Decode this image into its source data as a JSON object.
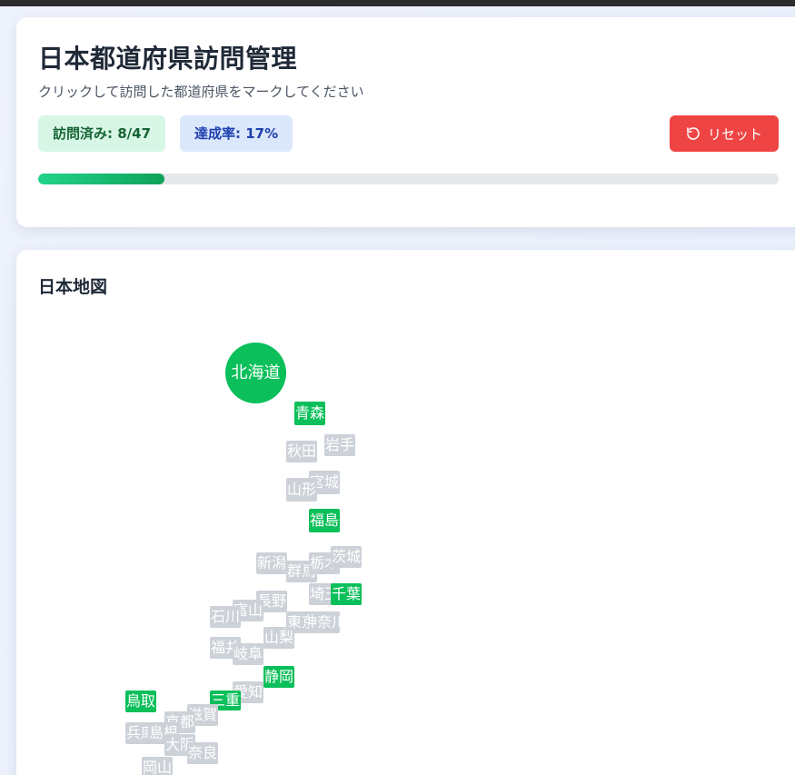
{
  "header": {
    "title": "日本都道府県訪問管理",
    "subtitle": "クリックして訪問した都道府県をマークしてください",
    "visited_label": "訪問済み: 8/47",
    "rate_label": "達成率: 17%",
    "reset_label": "リセット",
    "progress_percent": 17
  },
  "map": {
    "title": "日本地図",
    "prefectures": [
      {
        "name": "北海道",
        "visited": true
      },
      {
        "name": "青森",
        "visited": true
      },
      {
        "name": "岩手",
        "visited": false
      },
      {
        "name": "秋田",
        "visited": false
      },
      {
        "name": "宮城",
        "visited": false
      },
      {
        "name": "山形",
        "visited": false
      },
      {
        "name": "福島",
        "visited": true
      },
      {
        "name": "新潟",
        "visited": false
      },
      {
        "name": "群馬",
        "visited": false
      },
      {
        "name": "栃木",
        "visited": false
      },
      {
        "name": "茨城",
        "visited": false
      },
      {
        "name": "埼玉",
        "visited": false
      },
      {
        "name": "千葉",
        "visited": true
      },
      {
        "name": "長野",
        "visited": false
      },
      {
        "name": "富山",
        "visited": false
      },
      {
        "name": "石川",
        "visited": false
      },
      {
        "name": "東京",
        "visited": false
      },
      {
        "name": "神奈川",
        "visited": false
      },
      {
        "name": "山梨",
        "visited": false
      },
      {
        "name": "福井",
        "visited": false
      },
      {
        "name": "岐阜",
        "visited": false
      },
      {
        "name": "静岡",
        "visited": true
      },
      {
        "name": "愛知",
        "visited": false
      },
      {
        "name": "三重",
        "visited": true
      },
      {
        "name": "鳥取",
        "visited": true
      },
      {
        "name": "滋賀",
        "visited": false
      },
      {
        "name": "京都",
        "visited": false
      },
      {
        "name": "兵庫",
        "visited": false
      },
      {
        "name": "島根",
        "visited": false
      },
      {
        "name": "大阪",
        "visited": false
      },
      {
        "name": "奈良",
        "visited": false
      },
      {
        "name": "岡山",
        "visited": false
      }
    ]
  },
  "colors": {
    "visited": "#0bbf5a",
    "unvisited": "#cdd1d8",
    "reset": "#ef4444"
  },
  "icons": {
    "reset": "rotate-ccw-icon"
  }
}
